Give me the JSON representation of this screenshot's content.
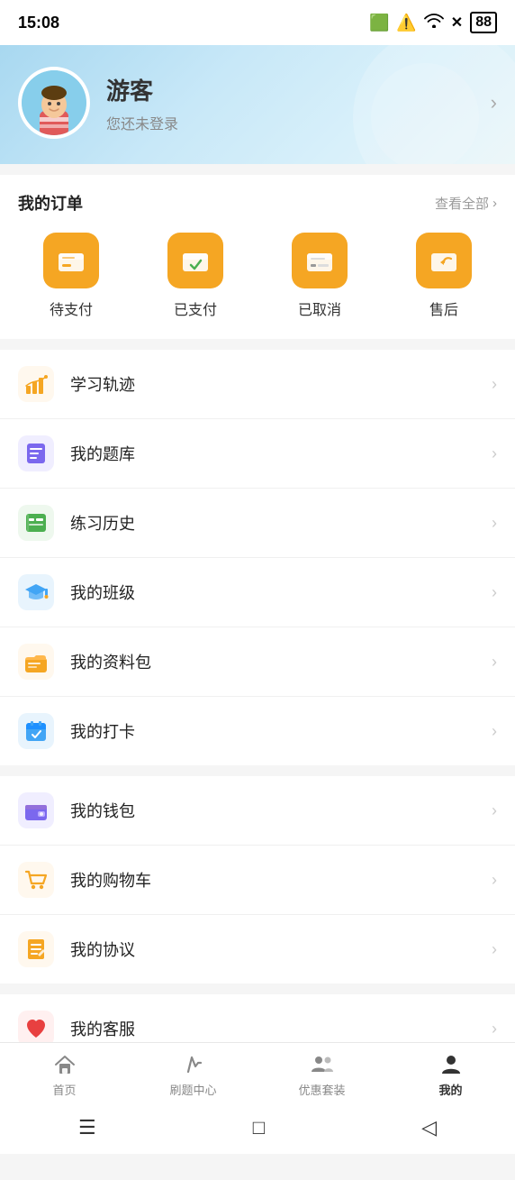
{
  "statusBar": {
    "time": "15:08",
    "batteryLevel": "88"
  },
  "profile": {
    "name": "游客",
    "subtitle": "您还未登录",
    "arrowLabel": "›"
  },
  "orders": {
    "sectionTitle": "我的订单",
    "viewAll": "查看全部",
    "viewAllArrow": "›",
    "items": [
      {
        "id": "pending",
        "label": "待支付"
      },
      {
        "id": "paid",
        "label": "已支付"
      },
      {
        "id": "cancelled",
        "label": "已取消"
      },
      {
        "id": "aftersale",
        "label": "售后"
      }
    ]
  },
  "menu": {
    "groups": [
      {
        "items": [
          {
            "id": "study-track",
            "label": "学习轨迹",
            "iconColor": "#f5a623",
            "iconBg": "#fff8ee"
          },
          {
            "id": "question-bank",
            "label": "我的题库",
            "iconColor": "#7b68ee",
            "iconBg": "#f0eeff"
          },
          {
            "id": "practice-history",
            "label": "练习历史",
            "iconColor": "#4caf50",
            "iconBg": "#eef8ee"
          },
          {
            "id": "my-class",
            "label": "我的班级",
            "iconColor": "#42a5f5",
            "iconBg": "#e8f4fd"
          },
          {
            "id": "my-materials",
            "label": "我的资料包",
            "iconColor": "#f5a623",
            "iconBg": "#fff8ee"
          },
          {
            "id": "my-checkin",
            "label": "我的打卡",
            "iconColor": "#42a5f5",
            "iconBg": "#e8f4fd"
          }
        ]
      },
      {
        "items": [
          {
            "id": "my-wallet",
            "label": "我的钱包",
            "iconColor": "#7b68ee",
            "iconBg": "#f0eeff"
          },
          {
            "id": "my-cart",
            "label": "我的购物车",
            "iconColor": "#f5a623",
            "iconBg": "#fff8ee"
          },
          {
            "id": "my-agreement",
            "label": "我的协议",
            "iconColor": "#f5a623",
            "iconBg": "#fff8ee"
          }
        ]
      },
      {
        "items": [
          {
            "id": "my-service",
            "label": "我的客服",
            "iconColor": "#e84040",
            "iconBg": "#fff0f0"
          }
        ]
      }
    ]
  },
  "bottomNav": {
    "items": [
      {
        "id": "home",
        "label": "首页",
        "active": false
      },
      {
        "id": "practice",
        "label": "刷题中心",
        "active": false
      },
      {
        "id": "deals",
        "label": "优惠套装",
        "active": false
      },
      {
        "id": "mine",
        "label": "我的",
        "active": true
      }
    ]
  },
  "sysNav": {
    "menu": "☰",
    "home": "□",
    "back": "◁"
  }
}
